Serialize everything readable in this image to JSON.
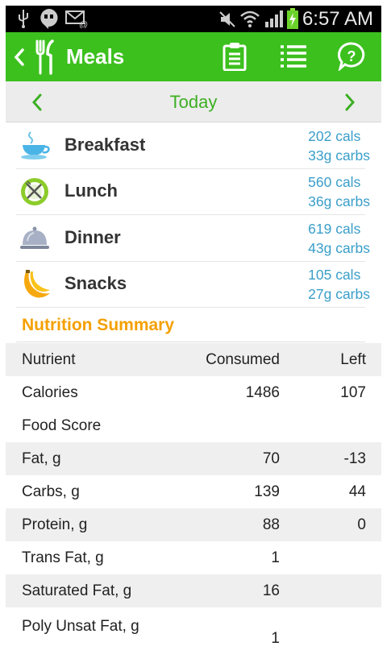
{
  "status_bar": {
    "time": "6:57 AM"
  },
  "app_bar": {
    "title": "Meals"
  },
  "date_nav": {
    "label": "Today"
  },
  "meals": [
    {
      "name": "Breakfast",
      "calories": "202 cals",
      "carbs": "33g carbs",
      "icon": "cup-icon"
    },
    {
      "name": "Lunch",
      "calories": "560 cals",
      "carbs": "36g carbs",
      "icon": "plate-utensils-icon"
    },
    {
      "name": "Dinner",
      "calories": "619 cals",
      "carbs": "43g carbs",
      "icon": "cloche-icon"
    },
    {
      "name": "Snacks",
      "calories": "105 cals",
      "carbs": "27g carbs",
      "icon": "banana-icon"
    }
  ],
  "summary": {
    "title": "Nutrition Summary",
    "headers": [
      "Nutrient",
      "Consumed",
      "Left"
    ],
    "rows": [
      {
        "nutrient": "Calories",
        "consumed": "1486",
        "left": "107"
      },
      {
        "nutrient": "Food Score",
        "consumed": "",
        "left": ""
      },
      {
        "nutrient": "Fat, g",
        "consumed": "70",
        "left": "-13"
      },
      {
        "nutrient": "Carbs, g",
        "consumed": "139",
        "left": "44"
      },
      {
        "nutrient": "Protein, g",
        "consumed": "88",
        "left": "0"
      },
      {
        "nutrient": "Trans Fat, g",
        "consumed": "1",
        "left": ""
      },
      {
        "nutrient": "Saturated Fat, g",
        "consumed": "16",
        "left": ""
      },
      {
        "nutrient": "Poly Unsat Fat, g",
        "consumed": "1",
        "left": ""
      }
    ]
  },
  "colors": {
    "accent_green": "#3cc01e",
    "summary_orange": "#f5a000",
    "cals_blue": "#3a9ec9"
  }
}
